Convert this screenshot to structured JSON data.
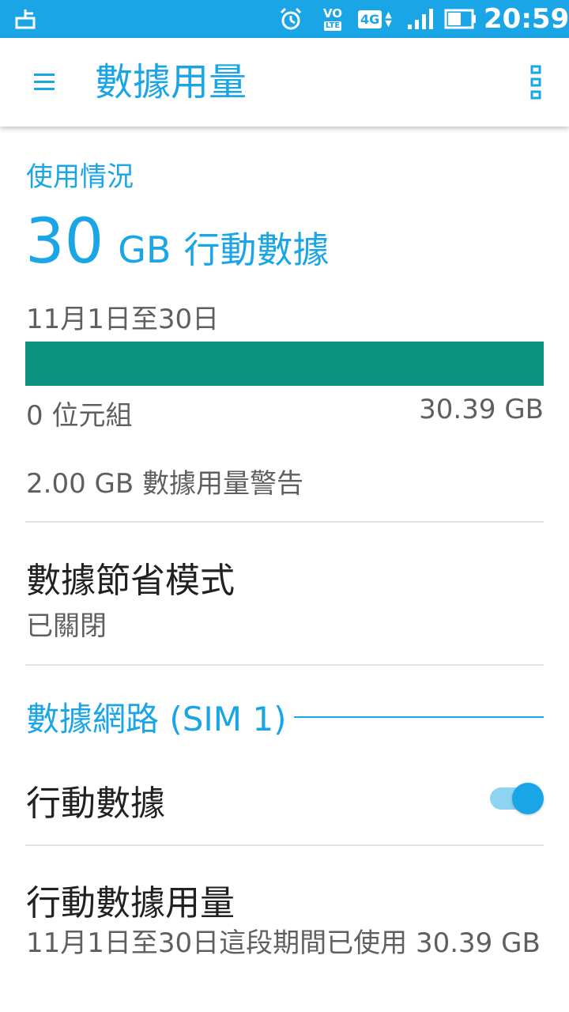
{
  "status_bar": {
    "time": "20:59",
    "volte_top": "VO",
    "volte_bottom": "LTE",
    "network_type": "4G",
    "icons": [
      "notification-icon",
      "alarm-icon",
      "volte-icon",
      "4g-icon",
      "signal-icon",
      "battery-icon"
    ]
  },
  "app_bar": {
    "title": "數據用量",
    "menu_icon": "hamburger-menu-icon",
    "overflow_icon": "more-vert-icon"
  },
  "usage": {
    "label": "使用情況",
    "amount": "30",
    "unit": "GB",
    "amount_label": "行動數據",
    "period": "11月1日至30日",
    "bar_min_label": "0 位元組",
    "bar_max_label": "30.39 GB",
    "bar_fill_fraction": 1.0,
    "bar_color": "#0d9180",
    "warning": "2.00 GB 數據用量警告"
  },
  "data_saver": {
    "title": "數據節省模式",
    "status": "已關閉"
  },
  "section": {
    "title": "數據網路 (SIM 1)"
  },
  "mobile_data": {
    "label": "行動數據",
    "enabled": true
  },
  "mobile_data_usage": {
    "title": "行動數據用量",
    "description": "11月1日至30日這段期間已使用 30.39 GB"
  },
  "colors": {
    "accent": "#1aa5e6",
    "status_bar": "#1aa5e6",
    "primary_text": "#212121",
    "secondary_text": "#5f5f5f"
  }
}
